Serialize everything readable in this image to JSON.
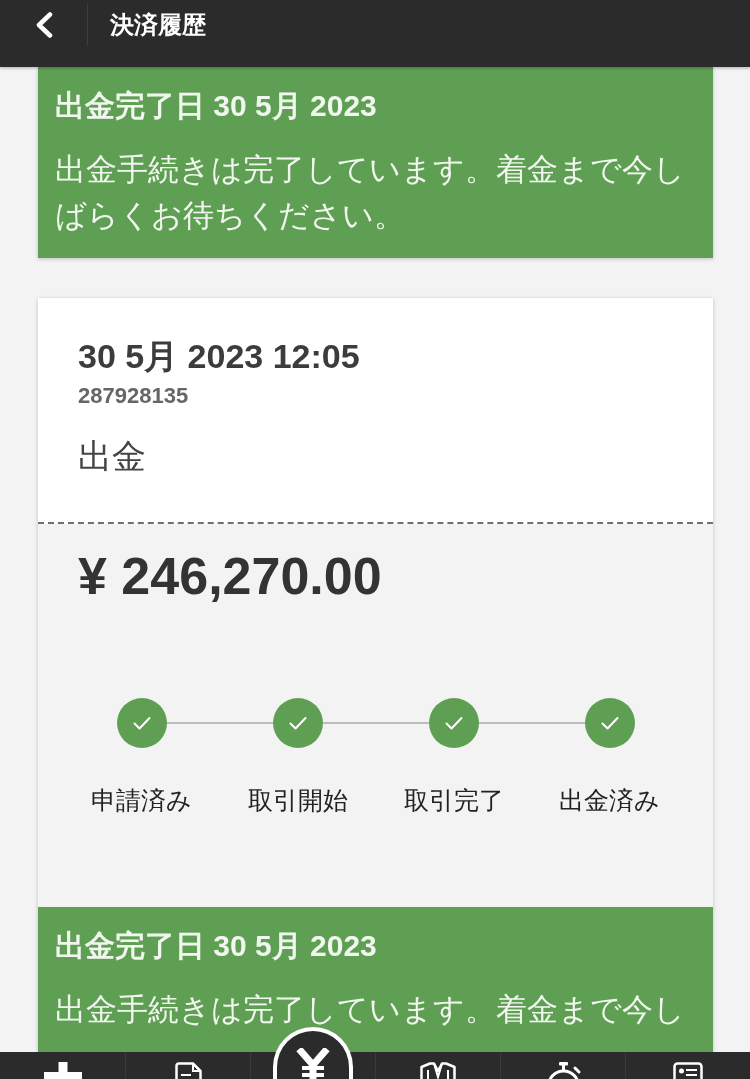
{
  "header": {
    "title": "決済履歴"
  },
  "transactions": [
    {
      "status_banner": {
        "title": "出金完了日 30 5月 2023",
        "message": "出金手続きは完了しています。着金まで今しばらくお待ちください。"
      }
    },
    {
      "datetime": "30 5月 2023 12:05",
      "id": "287928135",
      "type": "出金",
      "amount": "¥ 246,270.00",
      "steps": [
        {
          "label": "申請済み",
          "done": true
        },
        {
          "label": "取引開始",
          "done": true
        },
        {
          "label": "取引完了",
          "done": true
        },
        {
          "label": "出金済み",
          "done": true
        }
      ],
      "status_banner": {
        "title": "出金完了日 30 5月 2023",
        "message": "出金手続きは完了しています。着金まで今し"
      }
    }
  ],
  "bottom_nav": [
    {
      "kind": "plus"
    },
    {
      "kind": "document"
    },
    {
      "kind": "yen"
    },
    {
      "kind": "shirt"
    },
    {
      "kind": "stopwatch"
    },
    {
      "kind": "id-card"
    }
  ]
}
